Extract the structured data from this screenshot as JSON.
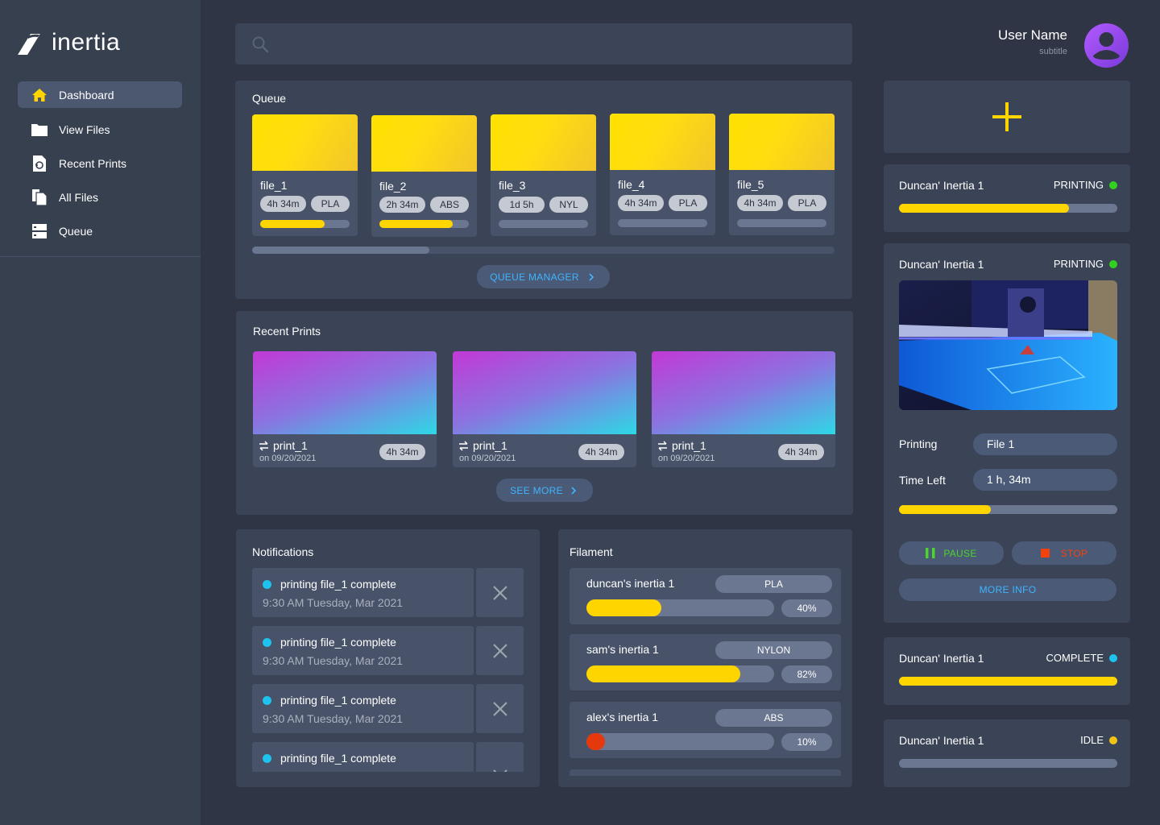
{
  "app": {
    "name": "inertia"
  },
  "sidebar": {
    "items": [
      {
        "label": "Dashboard",
        "icon": "home-icon",
        "active": true
      },
      {
        "label": "View Files",
        "icon": "folder-icon"
      },
      {
        "label": "Recent Prints",
        "icon": "recent-file-icon"
      },
      {
        "label": "All Files",
        "icon": "files-icon"
      },
      {
        "label": "Queue",
        "icon": "queue-icon"
      }
    ]
  },
  "search": {
    "placeholder": ""
  },
  "user": {
    "name": "User Name",
    "subtitle": "subtitle"
  },
  "queue": {
    "title": "Queue",
    "items": [
      {
        "name": "file_1",
        "time": "4h 34m",
        "material": "PLA",
        "progress": 0.72
      },
      {
        "name": "file_2",
        "time": "2h 34m",
        "material": "ABS",
        "progress": 0.82
      },
      {
        "name": "file_3",
        "time": "1d 5h",
        "material": "NYL",
        "progress": 0
      },
      {
        "name": "file_4",
        "time": "4h 34m",
        "material": "PLA",
        "progress": 0
      },
      {
        "name": "file_5",
        "time": "4h 34m",
        "material": "PLA",
        "progress": 0
      }
    ],
    "button_label": "QUEUE MANAGER"
  },
  "recent": {
    "title": "Recent Prints",
    "items": [
      {
        "name": "print_1",
        "date": "on 09/20/2021",
        "time": "4h 34m"
      },
      {
        "name": "print_1",
        "date": "on 09/20/2021",
        "time": "4h 34m"
      },
      {
        "name": "print_1",
        "date": "on 09/20/2021",
        "time": "4h 34m"
      }
    ],
    "button_label": "SEE MORE"
  },
  "notifications": {
    "title": "Notifications",
    "items": [
      {
        "title": "printing file_1 complete",
        "time": "9:30 AM Tuesday, Mar 2021"
      },
      {
        "title": "printing file_1 complete",
        "time": "9:30 AM Tuesday, Mar 2021"
      },
      {
        "title": "printing file_1 complete",
        "time": "9:30 AM Tuesday, Mar 2021"
      },
      {
        "title": "printing file_1 complete",
        "time": ""
      }
    ]
  },
  "filament": {
    "title": "Filament",
    "items": [
      {
        "printer": "duncan's inertia 1",
        "material": "PLA",
        "percent_label": "40%",
        "level": 0.4,
        "color": "#ffd500"
      },
      {
        "printer": "sam's inertia 1",
        "material": "NYLON",
        "percent_label": "82%",
        "level": 0.82,
        "color": "#ffd500"
      },
      {
        "printer": "alex's inertia 1",
        "material": "ABS",
        "percent_label": "10%",
        "level": 0.1,
        "color": "#e5380c"
      }
    ]
  },
  "printers": {
    "add_icon": "plus-icon",
    "cards": [
      {
        "name": "Duncan' Inertia 1",
        "status": "PRINTING",
        "status_color": "#33d11f",
        "progress": 0.78
      },
      {
        "name": "Duncan' Inertia 1",
        "status": "PRINTING",
        "status_color": "#33d11f",
        "printing_label": "Printing",
        "printing_value": "File 1",
        "time_label": "Time Left",
        "time_value": "1 h, 34m",
        "progress": 0.42,
        "pause_label": "PAUSE",
        "stop_label": "STOP",
        "more_label": "MORE INFO"
      },
      {
        "name": "Duncan' Inertia 1",
        "status": "COMPLETE",
        "status_color": "#1ec2ee",
        "progress": 1.0
      },
      {
        "name": "Duncan' Inertia 1",
        "status": "IDLE",
        "status_color": "#f3c318",
        "progress": 0
      }
    ]
  },
  "colors": {
    "accent": "#ffd500",
    "link": "#3fb4ff",
    "background": "#2f3544",
    "card": "#3a4456"
  }
}
